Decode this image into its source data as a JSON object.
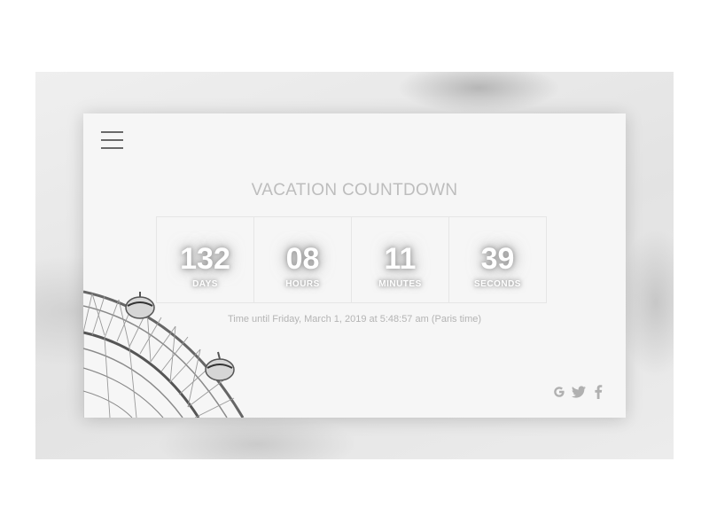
{
  "header": {
    "title": "VACATION COUNTDOWN"
  },
  "countdown": [
    {
      "value": "132",
      "label": "DAYS"
    },
    {
      "value": "08",
      "label": "HOURS"
    },
    {
      "value": "11",
      "label": "MINUTES"
    },
    {
      "value": "39",
      "label": "SECONDS"
    }
  ],
  "target_text": "Time until Friday, March 1, 2019 at 5:48:57 am (Paris time)",
  "icons": {
    "menu": "hamburger-menu-icon",
    "social": [
      "google-icon",
      "twitter-icon",
      "facebook-icon"
    ]
  },
  "colors": {
    "card_background": "#f6f6f6",
    "title_text": "#bdbdbd",
    "icon_gray": "#b0b0b0"
  }
}
